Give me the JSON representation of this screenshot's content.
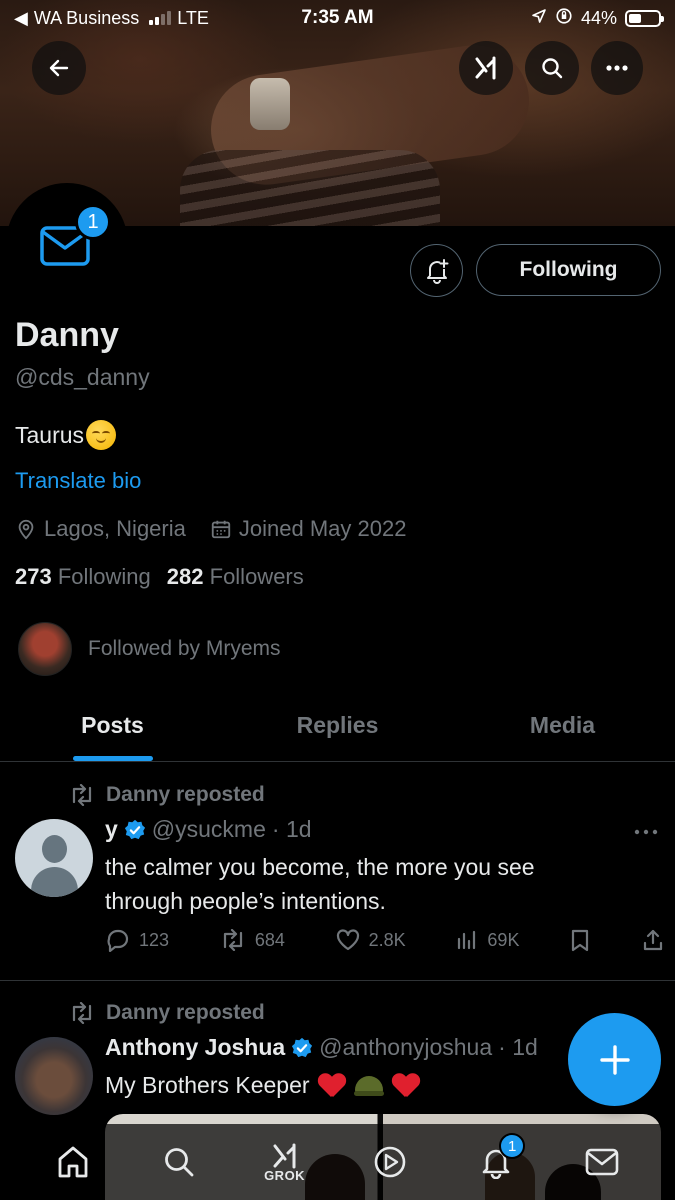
{
  "status_bar": {
    "back_app": "WA Business",
    "carrier": "LTE",
    "time": "7:35 AM",
    "battery": "44%",
    "battery_level": 0.44
  },
  "profile": {
    "name": "Danny",
    "handle": "@cds_danny",
    "bio": "Taurus",
    "translate_label": "Translate bio",
    "location": "Lagos, Nigeria",
    "joined": "Joined May 2022",
    "following_count": "273",
    "following_label": "Following",
    "followers_count": "282",
    "followers_label": "Followers",
    "followed_by": "Followed by Mryems",
    "messages_badge": "1"
  },
  "actions": {
    "following_button": "Following"
  },
  "tabs": [
    {
      "label": "Posts",
      "active": true
    },
    {
      "label": "Replies",
      "active": false
    },
    {
      "label": "Media",
      "active": false
    }
  ],
  "posts": [
    {
      "repost_label": "Danny reposted",
      "name": "y",
      "handle": "@ysuckme",
      "time": "· 1d",
      "text_line1": "the calmer you become, the more you see",
      "text_line2": "through people’s intentions.",
      "replies": "123",
      "reposts": "684",
      "likes": "2.8K",
      "views": "69K"
    },
    {
      "repost_label": "Danny reposted",
      "name": "Anthony Joshua",
      "handle": "@anthonyjoshua",
      "time": "· 1d",
      "text": "My Brothers Keeper"
    }
  ],
  "bottom_nav": {
    "grok_label": "GROK",
    "notifications_badge": "1"
  },
  "colors": {
    "accent": "#1d9bf0",
    "muted": "#71767b",
    "text": "#e7e9ea",
    "background": "#000000"
  }
}
